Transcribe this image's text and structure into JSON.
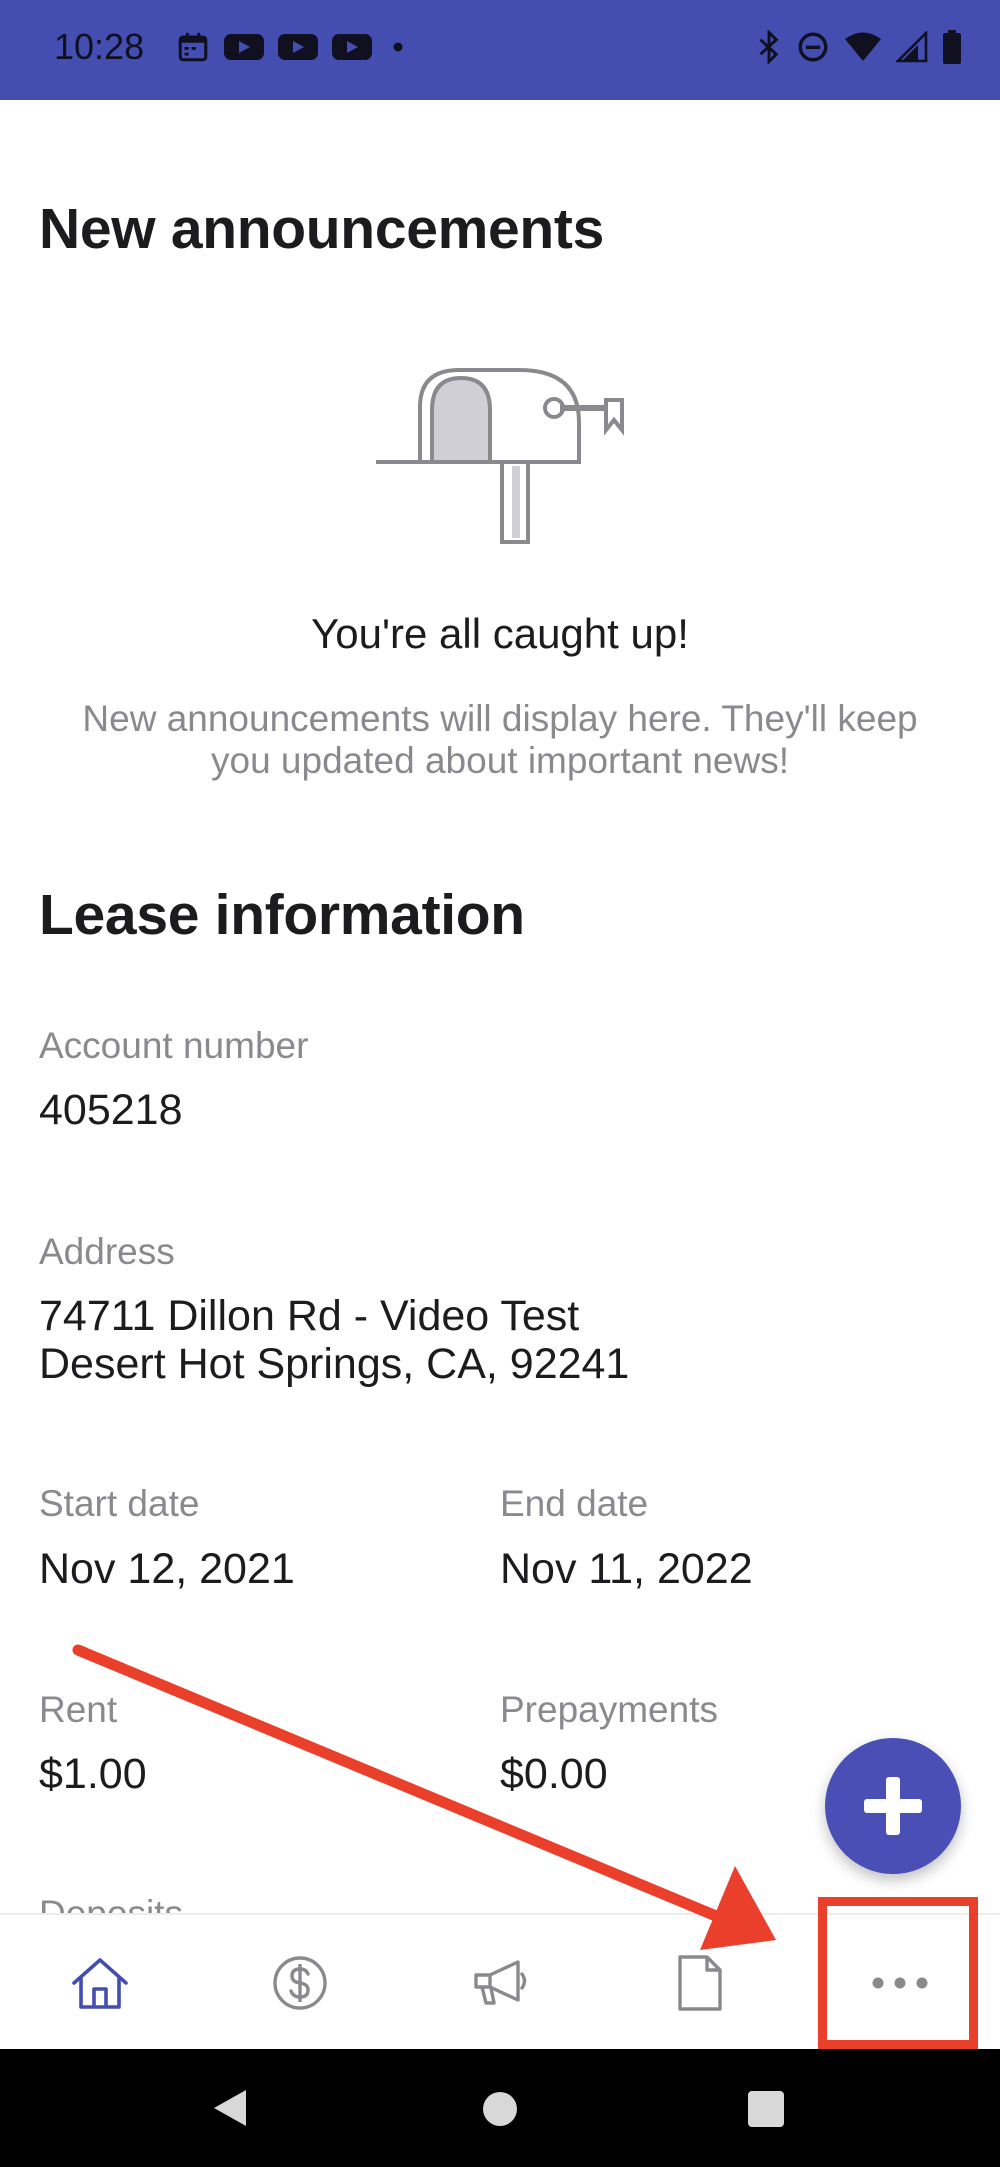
{
  "status_bar": {
    "time": "10:28",
    "bg_color": "#434eb0",
    "left_icons": [
      "calendar-icon",
      "youtube-icon",
      "youtube-icon",
      "youtube-icon",
      "dot-icon"
    ],
    "right_icons": [
      "bluetooth-icon",
      "do-not-disturb-icon",
      "wifi-icon",
      "signal-icon",
      "battery-icon"
    ]
  },
  "announcements": {
    "title": "New announcements",
    "empty_title": "You're all caught up!",
    "empty_subtitle": "New announcements will display here. They'll keep you updated about important news!"
  },
  "lease": {
    "title": "Lease information",
    "account_number_label": "Account number",
    "account_number": "405218",
    "address_label": "Address",
    "address_line1": "74711 Dillon Rd - Video Test",
    "address_line2": "Desert Hot Springs, CA, 92241",
    "start_date_label": "Start date",
    "start_date": "Nov 12, 2021",
    "end_date_label": "End date",
    "end_date": "Nov 11, 2022",
    "rent_label": "Rent",
    "rent": "$1.00",
    "prepayments_label": "Prepayments",
    "prepayments": "$0.00",
    "deposits_label": "Deposits"
  },
  "fab": {
    "icon": "plus-icon",
    "color": "#4a4fb6"
  },
  "bottom_nav": {
    "items": [
      {
        "icon": "home-icon",
        "active": true
      },
      {
        "icon": "dollar-icon",
        "active": false
      },
      {
        "icon": "megaphone-icon",
        "active": false
      },
      {
        "icon": "document-icon",
        "active": false
      },
      {
        "icon": "more-icon",
        "active": false
      }
    ],
    "active_color": "#434eb0",
    "inactive_color": "#8a8a8e"
  },
  "annotation": {
    "color": "#ea3f2b"
  }
}
